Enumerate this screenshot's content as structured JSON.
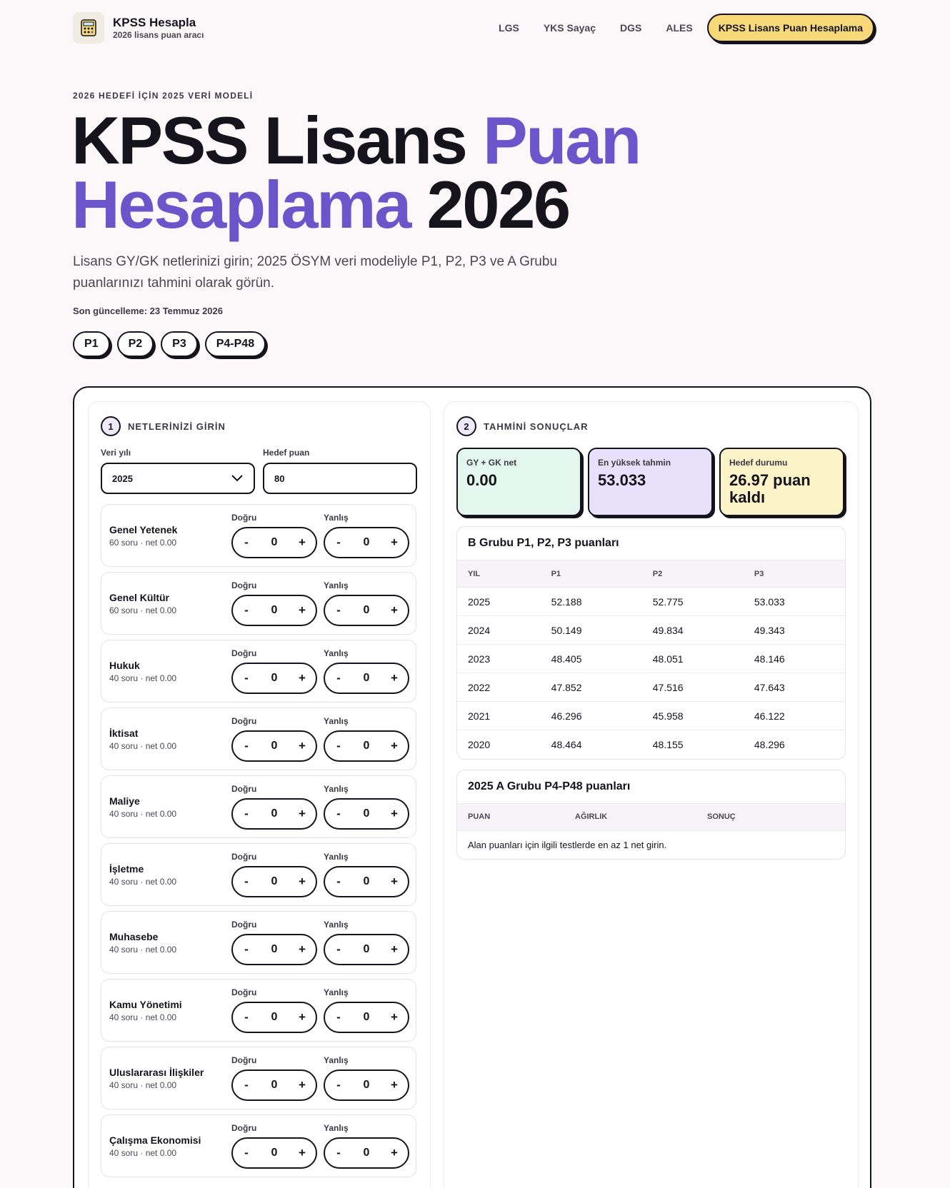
{
  "header": {
    "brand_name": "KPSS Hesapla",
    "brand_tagline": "2026 lisans puan aracı",
    "logo_icon": "calculator-icon",
    "nav": [
      "LGS",
      "YKS Sayaç",
      "DGS",
      "ALES"
    ],
    "cta_label": "KPSS Lisans Puan Hesaplama"
  },
  "hero": {
    "eyebrow": "2026 HEDEFİ İÇİN 2025 VERİ MODELİ",
    "title_part1": "KPSS Lisans ",
    "title_accent1": "Puan",
    "title_accent2": "Hesaplama",
    "title_part2": " 2026",
    "subtitle": "Lisans GY/GK netlerinizi girin; 2025 ÖSYM veri modeliyle P1, P2, P3 ve A Grubu puanlarınızı tahmini olarak görün.",
    "updated": "Son güncelleme: 23 Temmuz 2026",
    "chips": [
      "P1",
      "P2",
      "P3",
      "P4-P48"
    ]
  },
  "colors": {
    "accent": "#6b55cb",
    "cta": "#f7d97a",
    "stat_green": "#e4f7ee",
    "stat_purple": "#e7e1fb",
    "stat_yellow": "#fcf3c8"
  },
  "input_panel": {
    "step": "1",
    "title": "NETLERİNİZİ GİRİN",
    "year_label": "Veri yılı",
    "year_value": "2025",
    "target_label": "Hedef puan",
    "target_value": "80",
    "correct_label": "Doğru",
    "wrong_label": "Yanlış",
    "minus": "-",
    "plus": "+",
    "subjects": [
      {
        "name": "Genel Yetenek",
        "meta": "60 soru · net 0.00",
        "correct": "0",
        "wrong": "0"
      },
      {
        "name": "Genel Kültür",
        "meta": "60 soru · net 0.00",
        "correct": "0",
        "wrong": "0"
      },
      {
        "name": "Hukuk",
        "meta": "40 soru · net 0.00",
        "correct": "0",
        "wrong": "0"
      },
      {
        "name": "İktisat",
        "meta": "40 soru · net 0.00",
        "correct": "0",
        "wrong": "0"
      },
      {
        "name": "Maliye",
        "meta": "40 soru · net 0.00",
        "correct": "0",
        "wrong": "0"
      },
      {
        "name": "İşletme",
        "meta": "40 soru · net 0.00",
        "correct": "0",
        "wrong": "0"
      },
      {
        "name": "Muhasebe",
        "meta": "40 soru · net 0.00",
        "correct": "0",
        "wrong": "0"
      },
      {
        "name": "Kamu Yönetimi",
        "meta": "40 soru · net 0.00",
        "correct": "0",
        "wrong": "0"
      },
      {
        "name": "Uluslararası İlişkiler",
        "meta": "40 soru · net 0.00",
        "correct": "0",
        "wrong": "0"
      },
      {
        "name": "Çalışma Ekonomisi",
        "meta": "40 soru · net 0.00",
        "correct": "0",
        "wrong": "0"
      }
    ]
  },
  "results_panel": {
    "step": "2",
    "title": "TAHMİNİ SONUÇLAR",
    "stats": [
      {
        "label": "GY + GK net",
        "value": "0.00"
      },
      {
        "label": "En yüksek tahmin",
        "value": "53.033"
      },
      {
        "label": "Hedef durumu",
        "value": "26.97 puan kaldı"
      }
    ],
    "b_group": {
      "title": "B Grubu P1, P2, P3 puanları",
      "headers": [
        "YIL",
        "P1",
        "P2",
        "P3"
      ],
      "rows": [
        [
          "2025",
          "52.188",
          "52.775",
          "53.033"
        ],
        [
          "2024",
          "50.149",
          "49.834",
          "49.343"
        ],
        [
          "2023",
          "48.405",
          "48.051",
          "48.146"
        ],
        [
          "2022",
          "47.852",
          "47.516",
          "47.643"
        ],
        [
          "2021",
          "46.296",
          "45.958",
          "46.122"
        ],
        [
          "2020",
          "48.464",
          "48.155",
          "48.296"
        ]
      ]
    },
    "a_group": {
      "title": "2025 A Grubu P4-P48 puanları",
      "headers": [
        "PUAN",
        "AĞIRLIK",
        "SONUÇ"
      ],
      "note": "Alan puanları için ilgili testlerde en az 1 net girin."
    }
  }
}
